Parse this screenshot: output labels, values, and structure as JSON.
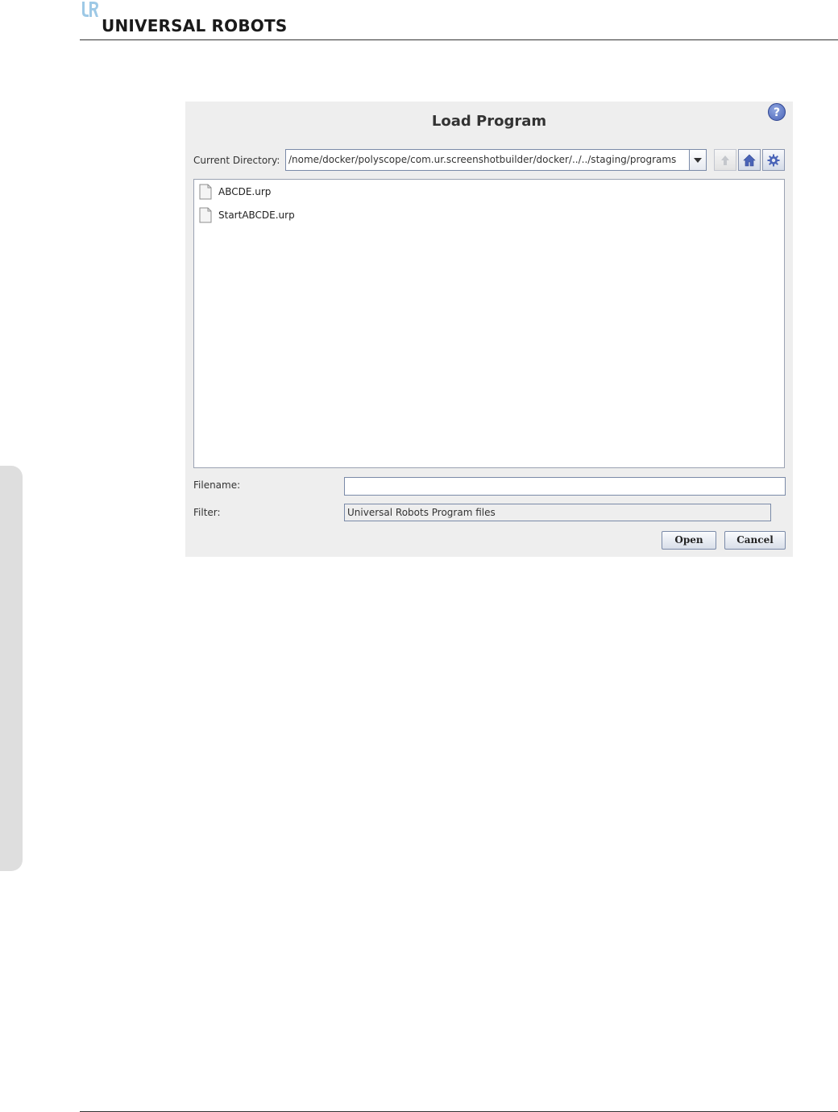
{
  "header": {
    "brand_name": "UNIVERSAL ROBOTS"
  },
  "dialog": {
    "title": "Load Program",
    "help_label": "?",
    "current_directory_label": "Current Directory:",
    "current_directory_value": "/nome/docker/polyscope/com.ur.screenshotbuilder/docker/../../staging/programs",
    "toolbar": {
      "up_icon": "arrow-up-icon",
      "home_icon": "home-icon",
      "settings_icon": "gear-icon"
    },
    "files": [
      {
        "name": "ABCDE.urp"
      },
      {
        "name": "StartABCDE.urp"
      }
    ],
    "filename_label": "Filename:",
    "filename_value": "",
    "filter_label": "Filter:",
    "filter_value": "Universal Robots Program files",
    "open_label": "Open",
    "cancel_label": "Cancel"
  },
  "colors": {
    "accent": "#4a64b8",
    "dialog_bg": "#eeeeee",
    "side_tab": "#dedede"
  }
}
